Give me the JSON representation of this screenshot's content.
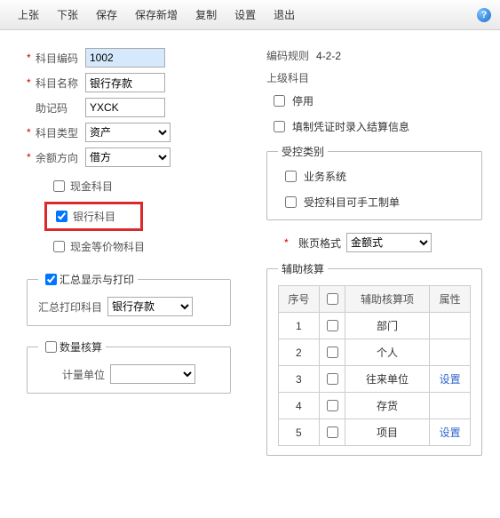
{
  "toolbar": {
    "prev": "上张",
    "next": "下张",
    "save": "保存",
    "save_new": "保存新增",
    "copy": "复制",
    "settings": "设置",
    "exit": "退出"
  },
  "left": {
    "code_label": "科目编码",
    "code_value": "1002",
    "name_label": "科目名称",
    "name_value": "银行存款",
    "mnemonic_label": "助记码",
    "mnemonic_value": "YXCK",
    "type_label": "科目类型",
    "type_value": "资产",
    "balance_label": "余额方向",
    "balance_value": "借方",
    "chk_cash": "现金科目",
    "chk_bank": "银行科目",
    "chk_cashlike": "现金等价物科目",
    "summary_legend": "汇总显示与打印",
    "summary_print_label": "汇总打印科目",
    "summary_print_value": "银行存款",
    "qty_legend": "数量核算",
    "unit_label": "计量单位"
  },
  "right": {
    "code_rule_label": "编码规则",
    "code_rule_value": "4-2-2",
    "parent_label": "上级科目",
    "chk_disabled": "停用",
    "chk_settle": "填制凭证时录入结算信息",
    "controlled_legend": "受控类别",
    "chk_biz": "业务系统",
    "chk_manual": "受控科目可手工制单",
    "accfmt_label": "账页格式",
    "accfmt_value": "金额式",
    "aux_legend": "辅助核算",
    "aux_headers": {
      "no": "序号",
      "chk": "",
      "item": "辅助核算项",
      "attr": "属性"
    },
    "aux_rows": [
      {
        "no": "1",
        "item": "部门",
        "attr": ""
      },
      {
        "no": "2",
        "item": "个人",
        "attr": ""
      },
      {
        "no": "3",
        "item": "往来单位",
        "attr": "设置"
      },
      {
        "no": "4",
        "item": "存货",
        "attr": ""
      },
      {
        "no": "5",
        "item": "项目",
        "attr": "设置"
      }
    ]
  }
}
